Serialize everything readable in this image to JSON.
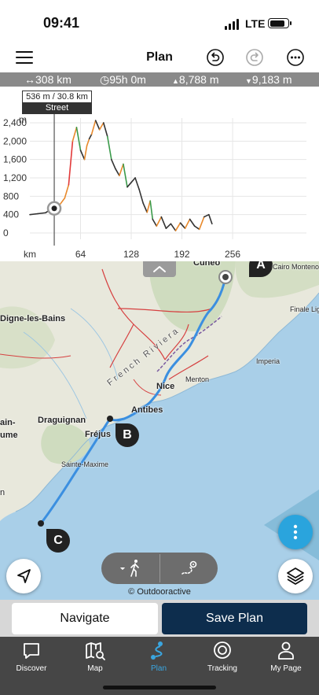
{
  "status": {
    "time": "09:41",
    "network": "LTE"
  },
  "header": {
    "title": "Plan"
  },
  "stats": {
    "distance": "↔308 km",
    "duration": "95h 0m",
    "ascent": "8,788 m",
    "descent": "9,183 m"
  },
  "tooltip": {
    "position": "536 m / 30.8 km",
    "surface": "Street"
  },
  "chart_data": {
    "type": "line",
    "ylabel": "m",
    "xlabel": "km",
    "y_ticks": [
      "2,400",
      "2,000",
      "1,600",
      "1,200",
      "800",
      "400",
      "0"
    ],
    "y_tick_values": [
      2400,
      2000,
      1600,
      1200,
      800,
      400,
      0
    ],
    "x_ticks": [
      "64",
      "128",
      "192",
      "256"
    ],
    "x_tick_values": [
      64,
      128,
      192,
      256
    ],
    "xlim": [
      0,
      320
    ],
    "ylim": [
      0,
      2600
    ],
    "cursor": {
      "x": 30.8,
      "y": 536
    },
    "series": [
      {
        "x": [
          0,
          10,
          20,
          28,
          33,
          38,
          44,
          49,
          54,
          59,
          64,
          69,
          72,
          75,
          78,
          83,
          88,
          93,
          98,
          103,
          108,
          113,
          118,
          123,
          128,
          133,
          138,
          143,
          148,
          152,
          155,
          160,
          166,
          172,
          178,
          184,
          190,
          196,
          202,
          208,
          214,
          220,
          226,
          230
        ],
        "y": [
          400,
          420,
          440,
          540,
          560,
          620,
          760,
          1050,
          2000,
          2300,
          1800,
          1600,
          1900,
          2050,
          2150,
          2450,
          2250,
          2400,
          2100,
          1600,
          1400,
          1250,
          1500,
          1000,
          1100,
          1200,
          950,
          650,
          450,
          700,
          300,
          150,
          350,
          100,
          200,
          50,
          220,
          100,
          300,
          150,
          80,
          350,
          400,
          200
        ]
      }
    ]
  },
  "map": {
    "labels": {
      "cuneo": "Cuneo",
      "cairo": "Cairo Montenot",
      "digne": "Digne-les-Bains",
      "finale": "Finale Lig",
      "imperia": "Imperia",
      "riviera": "French Riviera",
      "nice": "Nice",
      "menton": "Menton",
      "antibes": "Antibes",
      "draguignan": "Draguignan",
      "frejus": "Fréjus",
      "sainte_maxime": "Sainte-Maxime",
      "ain": "ain-",
      "ume": "ume",
      "n": "n"
    },
    "waypoints": {
      "a": "A",
      "b": "B",
      "c": "C"
    },
    "attribution": "© Outdooractive"
  },
  "actions": {
    "navigate": "Navigate",
    "save": "Save Plan"
  },
  "tabs": [
    {
      "label": "Discover",
      "icon": "discover-icon"
    },
    {
      "label": "Map",
      "icon": "map-icon"
    },
    {
      "label": "Plan",
      "icon": "plan-icon"
    },
    {
      "label": "Tracking",
      "icon": "tracking-icon"
    },
    {
      "label": "My Page",
      "icon": "user-icon"
    }
  ],
  "colors": {
    "route": "#3b8fe0",
    "active_tab": "#3aa6e0",
    "save_button": "#0d2d4d"
  }
}
